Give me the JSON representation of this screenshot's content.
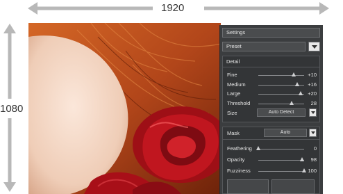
{
  "dimensions": {
    "width_label": "1920",
    "height_label": "1080"
  },
  "panel": {
    "settings_title": "Settings",
    "preset_label": "Preset",
    "detail": {
      "title": "Detail",
      "rows": [
        {
          "label": "Fine",
          "value": "+10",
          "level": 0.78
        },
        {
          "label": "Medium",
          "value": "+16",
          "level": 0.85
        },
        {
          "label": "Large",
          "value": "+20",
          "level": 0.93
        },
        {
          "label": "Threshold",
          "value": "28",
          "level": 0.72
        }
      ],
      "size_label": "Size",
      "size_value": "Auto Detect"
    },
    "mask": {
      "title": "Mask",
      "mode_value": "Auto",
      "rows": [
        {
          "label": "Feathering",
          "value": "0",
          "level": 0.0
        },
        {
          "label": "Opacity",
          "value": "98",
          "level": 0.96
        },
        {
          "label": "Fuzziness",
          "value": "100",
          "level": 1.0
        }
      ]
    }
  },
  "icons": [
    "dimension-arrow-horizontal",
    "dimension-arrow-vertical",
    "dropdown-arrow-icon"
  ],
  "colors": {
    "panel_bg": "#3b3d3f",
    "rose_red": "#b3141c",
    "hair": "#b5481a",
    "skin": "#f1d3bf"
  }
}
